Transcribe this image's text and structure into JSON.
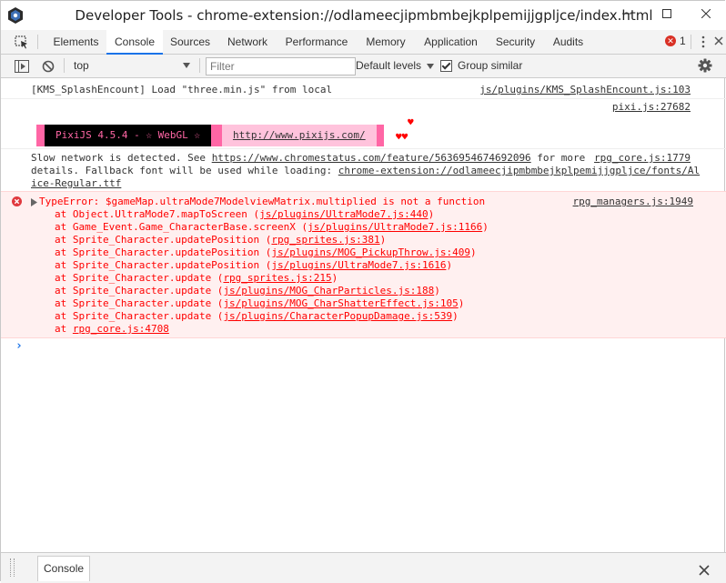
{
  "window": {
    "title": "Developer Tools - chrome-extension://odlameecjipmbmbejkplpemijjgpljce/index.html"
  },
  "tabs": {
    "items": [
      {
        "label": "Elements"
      },
      {
        "label": "Console"
      },
      {
        "label": "Sources"
      },
      {
        "label": "Network"
      },
      {
        "label": "Performance"
      },
      {
        "label": "Memory"
      },
      {
        "label": "Application"
      },
      {
        "label": "Security"
      },
      {
        "label": "Audits"
      }
    ],
    "active": "Console",
    "error_count": "1"
  },
  "toolbar": {
    "context": "top",
    "filter_placeholder": "Filter",
    "levels": "Default levels",
    "group_similar": "Group similar",
    "group_similar_checked": true
  },
  "console": {
    "msg1": {
      "text": "[KMS_SplashEncount] Load \"three.min.js\" from local",
      "source": "js/plugins/KMS_SplashEncount.js:103"
    },
    "msg2": {
      "source": "pixi.js:27682",
      "banner_text": "PixiJS 4.5.4 - ☆ WebGL ☆",
      "banner_link": "http://www.pixijs.com/",
      "hearts_top": "♥",
      "hearts_bottom": "♥♥"
    },
    "msg3": {
      "line1_prefix": "Slow network is detected. See ",
      "line1_link": "https://www.chromestatus.com/feature/5636954674692096",
      "line1_suffix": " for more",
      "line2_prefix": "details. Fallback font will be used while loading: ",
      "line2_link": "chrome-extension://odlameecjipmbmbejkplpemijjgpljce/fonts/Al",
      "line3_link": "ice-Regular.ttf",
      "source": "rpg_core.js:1779"
    },
    "error": {
      "message": "TypeError: $gameMap.ultraMode7ModelviewMatrix.multiplied is not a function",
      "source": "rpg_managers.js:1949",
      "stack": [
        {
          "fn": "at Object.UltraMode7.mapToScreen (",
          "loc": "js/plugins/UltraMode7.js:440",
          "end": ")"
        },
        {
          "fn": "at Game_Event.Game_CharacterBase.screenX (",
          "loc": "js/plugins/UltraMode7.js:1166",
          "end": ")"
        },
        {
          "fn": "at Sprite_Character.updatePosition (",
          "loc": "rpg_sprites.js:381",
          "end": ")"
        },
        {
          "fn": "at Sprite_Character.updatePosition (",
          "loc": "js/plugins/MOG_PickupThrow.js:409",
          "end": ")"
        },
        {
          "fn": "at Sprite_Character.updatePosition (",
          "loc": "js/plugins/UltraMode7.js:1616",
          "end": ")"
        },
        {
          "fn": "at Sprite_Character.update (",
          "loc": "rpg_sprites.js:215",
          "end": ")"
        },
        {
          "fn": "at Sprite_Character.update (",
          "loc": "js/plugins/MOG_CharParticles.js:188",
          "end": ")"
        },
        {
          "fn": "at Sprite_Character.update (",
          "loc": "js/plugins/MOG_CharShatterEffect.js:105",
          "end": ")"
        },
        {
          "fn": "at Sprite_Character.update (",
          "loc": "js/plugins/CharacterPopupDamage.js:539",
          "end": ")"
        },
        {
          "fn": "at ",
          "loc": "rpg_core.js:4708",
          "end": ""
        }
      ]
    },
    "prompt": "›"
  },
  "drawer": {
    "tab_label": "Console"
  },
  "colors": {
    "error_red": "#ff0000",
    "error_bg": "#fff0f0",
    "pixi_pink": "#ff66a5",
    "pixi_light": "#ffc3dc",
    "active_tab": "#1a73e8",
    "prompt_blue": "#1a73e8"
  }
}
